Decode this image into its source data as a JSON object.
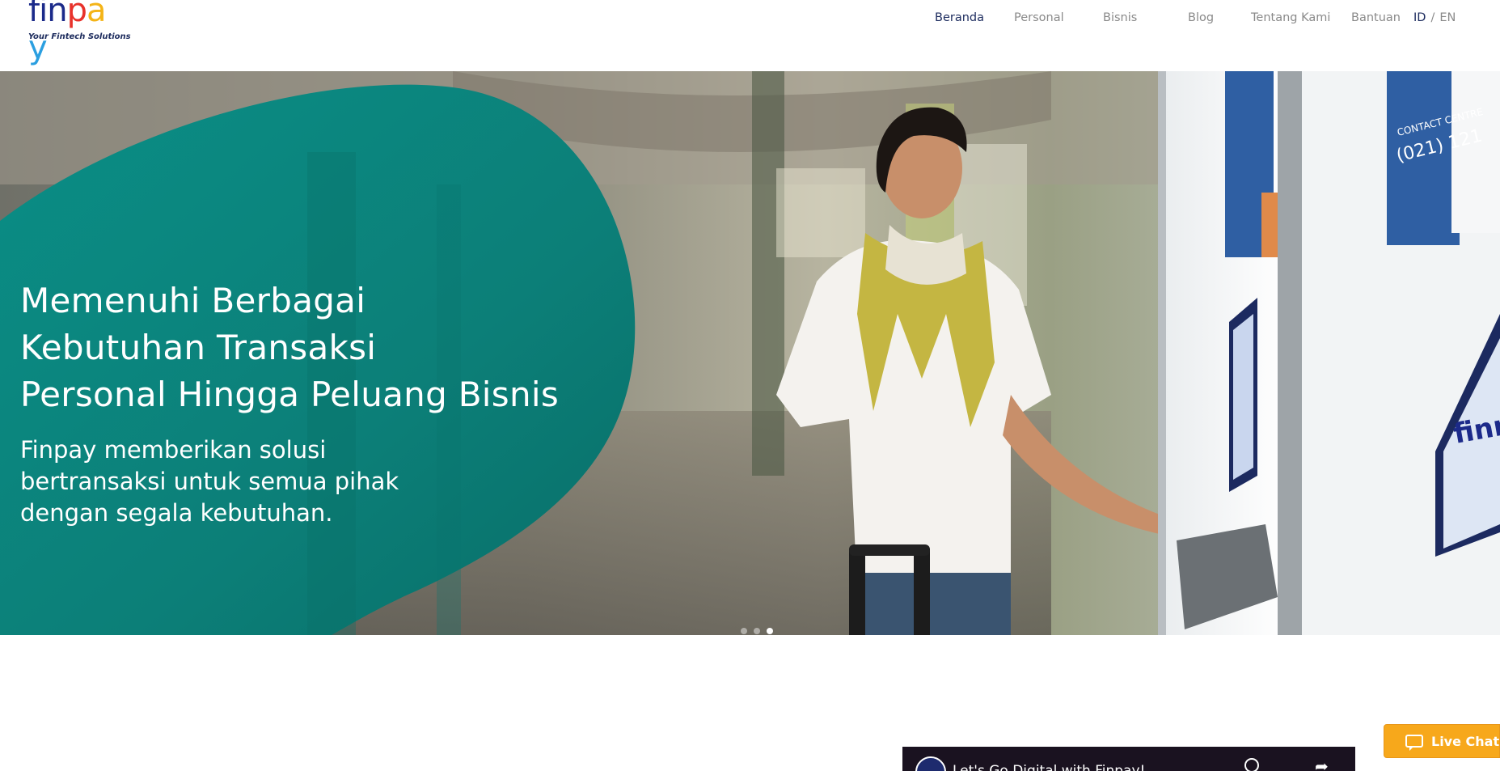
{
  "brand": {
    "logo_text": "finpay",
    "tagline": "Your Fintech Solutions",
    "colors": [
      "#1b2a8a",
      "#e8322b",
      "#f4b417",
      "#2b9fe0",
      "#6bbf3a"
    ]
  },
  "nav": {
    "items": [
      {
        "label": "Beranda",
        "active": true
      },
      {
        "label": "Personal",
        "active": false
      },
      {
        "label": "Bisnis",
        "active": false
      },
      {
        "label": "Blog",
        "active": false
      },
      {
        "label": "Tentang Kami",
        "active": false
      },
      {
        "label": "Bantuan",
        "active": false
      }
    ],
    "lang": {
      "id": "ID",
      "separator": "/",
      "en": "EN",
      "active": "ID"
    }
  },
  "hero": {
    "title_lines": [
      "Memenuhi Berbagai",
      "Kebutuhan Transaksi",
      "Personal Hingga Peluang Bisnis"
    ],
    "subtitle_lines": [
      "Finpay memberikan solusi",
      "bertransaksi untuk semua pihak",
      "dengan segala kebutuhan."
    ],
    "kiosk_texts": [
      "CONTACT CENTRE",
      "(021) 121",
      "finne"
    ],
    "accent_color": "#0f8f88",
    "slides": {
      "count": 3,
      "active": 3
    }
  },
  "video": {
    "title": "Let's Go Digital with Finpay!",
    "icons": [
      "channel-logo-icon",
      "clock-icon",
      "share-icon"
    ]
  },
  "livechat": {
    "label": "Live Chat",
    "color": "#f7a81b"
  }
}
